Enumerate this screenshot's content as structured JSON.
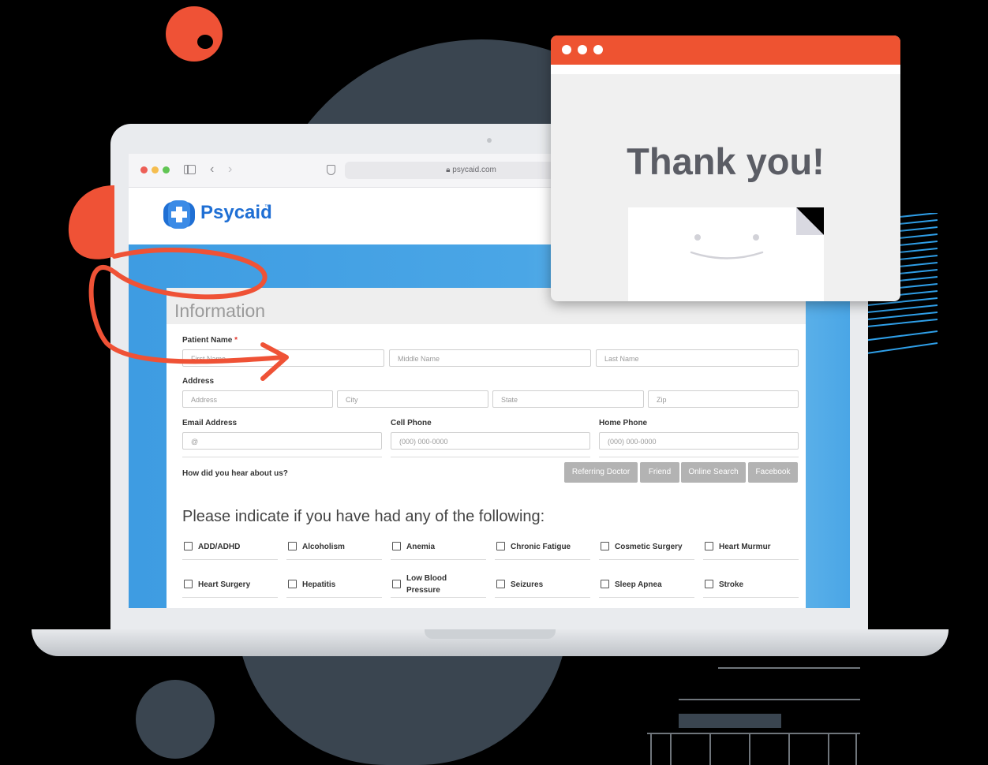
{
  "browser": {
    "url": "psycaid.com"
  },
  "brand": {
    "name": "Psycaid",
    "trademark": "™",
    "primary_color": "#1f6fd4",
    "accent_color": "#ee5331"
  },
  "form": {
    "title": "Information",
    "patient_name_label": "Patient Name",
    "required_mark": "*",
    "first_name_placeholder": "First Name",
    "middle_name_placeholder": "Middle Name",
    "last_name_placeholder": "Last Name",
    "address_label": "Address",
    "address_placeholder": "Address",
    "city_placeholder": "City",
    "state_placeholder": "State",
    "zip_placeholder": "Zip",
    "email_label": "Email Address",
    "email_placeholder": "@",
    "cell_label": "Cell Phone",
    "cell_placeholder": "(000) 000-0000",
    "home_label": "Home Phone",
    "home_placeholder": "(000) 000-0000",
    "hear_label": "How did you hear about us?",
    "sources": [
      "Referring Doctor",
      "Friend",
      "Online Search",
      "Facebook"
    ],
    "conditions_title": "Please indicate if you have had any of the following:",
    "conditions": [
      "ADD/ADHD",
      "Alcoholism",
      "Anemia",
      "Chronic Fatigue",
      "Cosmetic Surgery",
      "Heart Murmur",
      "Heart Surgery",
      "Hepatitis",
      "Low Blood Pressure",
      "Seizures",
      "Sleep Apnea",
      "Stroke"
    ]
  },
  "popup": {
    "message": "Thank you!"
  }
}
